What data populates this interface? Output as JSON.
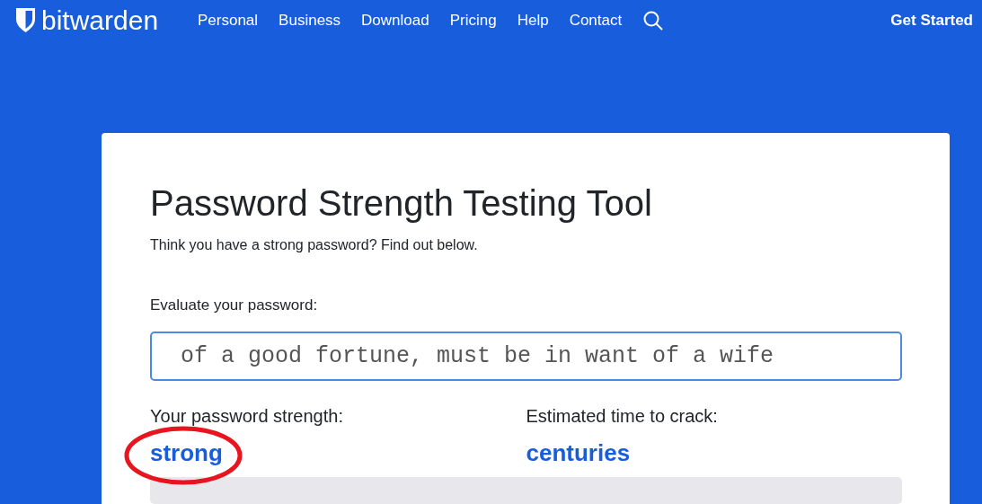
{
  "header": {
    "logo": "**bit**warden",
    "nav": [
      {
        "label": "Personal"
      },
      {
        "label": "Business"
      },
      {
        "label": "Download"
      },
      {
        "label": "Pricing"
      },
      {
        "label": "Help"
      },
      {
        "label": "Contact"
      }
    ],
    "cta": "Get Started"
  },
  "card": {
    "title": "Password Strength Testing Tool",
    "subtitle": "Think you have a strong password? Find out below.",
    "field_label": "Evaluate your password:",
    "password": "of a good fortune, must be in want of a wife",
    "results": [
      {
        "label": "Your password strength:",
        "value": "strong",
        "circled": true
      },
      {
        "label": "Estimated time to crack:",
        "value": "centuries",
        "circled": false
      }
    ]
  }
}
